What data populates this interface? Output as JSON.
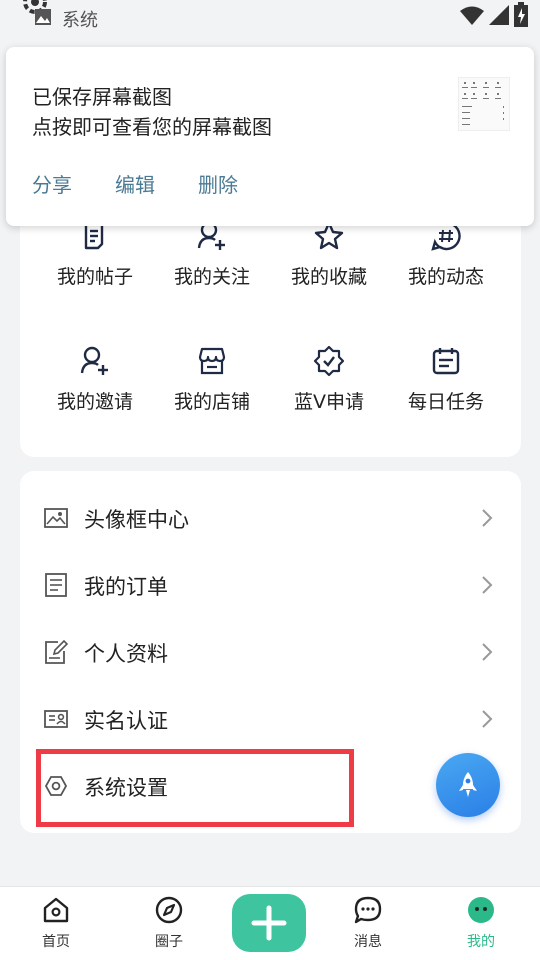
{
  "status_bar": {
    "label": "系统",
    "icons": [
      "gear-icon",
      "image-icon",
      "wifi-icon",
      "signal-icon",
      "battery-charging-icon"
    ]
  },
  "notification": {
    "title": "已保存屏幕截图",
    "subtitle": "点按即可查看您的屏幕截图",
    "actions": [
      "分享",
      "编辑",
      "删除"
    ],
    "action_color": "#4b7a94"
  },
  "grid": {
    "items": [
      {
        "label": "我的帖子",
        "icon": "post-icon"
      },
      {
        "label": "我的关注",
        "icon": "follow-icon"
      },
      {
        "label": "我的收藏",
        "icon": "star-icon"
      },
      {
        "label": "我的动态",
        "icon": "hashtag-icon"
      },
      {
        "label": "我的邀请",
        "icon": "invite-icon"
      },
      {
        "label": "我的店铺",
        "icon": "store-icon"
      },
      {
        "label": "蓝V申请",
        "icon": "verified-badge-icon"
      },
      {
        "label": "每日任务",
        "icon": "calendar-task-icon"
      }
    ]
  },
  "settings_list": {
    "items": [
      {
        "label": "头像框中心",
        "icon": "avatar-frame-icon",
        "has_chevron": true
      },
      {
        "label": "我的订单",
        "icon": "order-icon",
        "has_chevron": true
      },
      {
        "label": "个人资料",
        "icon": "edit-profile-icon",
        "has_chevron": true
      },
      {
        "label": "实名认证",
        "icon": "id-card-icon",
        "has_chevron": true
      },
      {
        "label": "系统设置",
        "icon": "settings-hexagon-icon",
        "has_chevron": false
      }
    ],
    "highlighted": "系统设置",
    "highlight_color": "#ef3b45"
  },
  "floating_button": {
    "icon": "rocket-icon"
  },
  "bottom_nav": {
    "items": [
      {
        "label": "首页",
        "icon": "home-icon"
      },
      {
        "label": "圈子",
        "icon": "compass-icon"
      },
      {
        "label": "消息",
        "icon": "chat-icon"
      },
      {
        "label": "我的",
        "icon": "profile-face-icon",
        "active": true
      }
    ],
    "center_button_icon": "plus-icon",
    "accent_color": "#2bb98a"
  }
}
